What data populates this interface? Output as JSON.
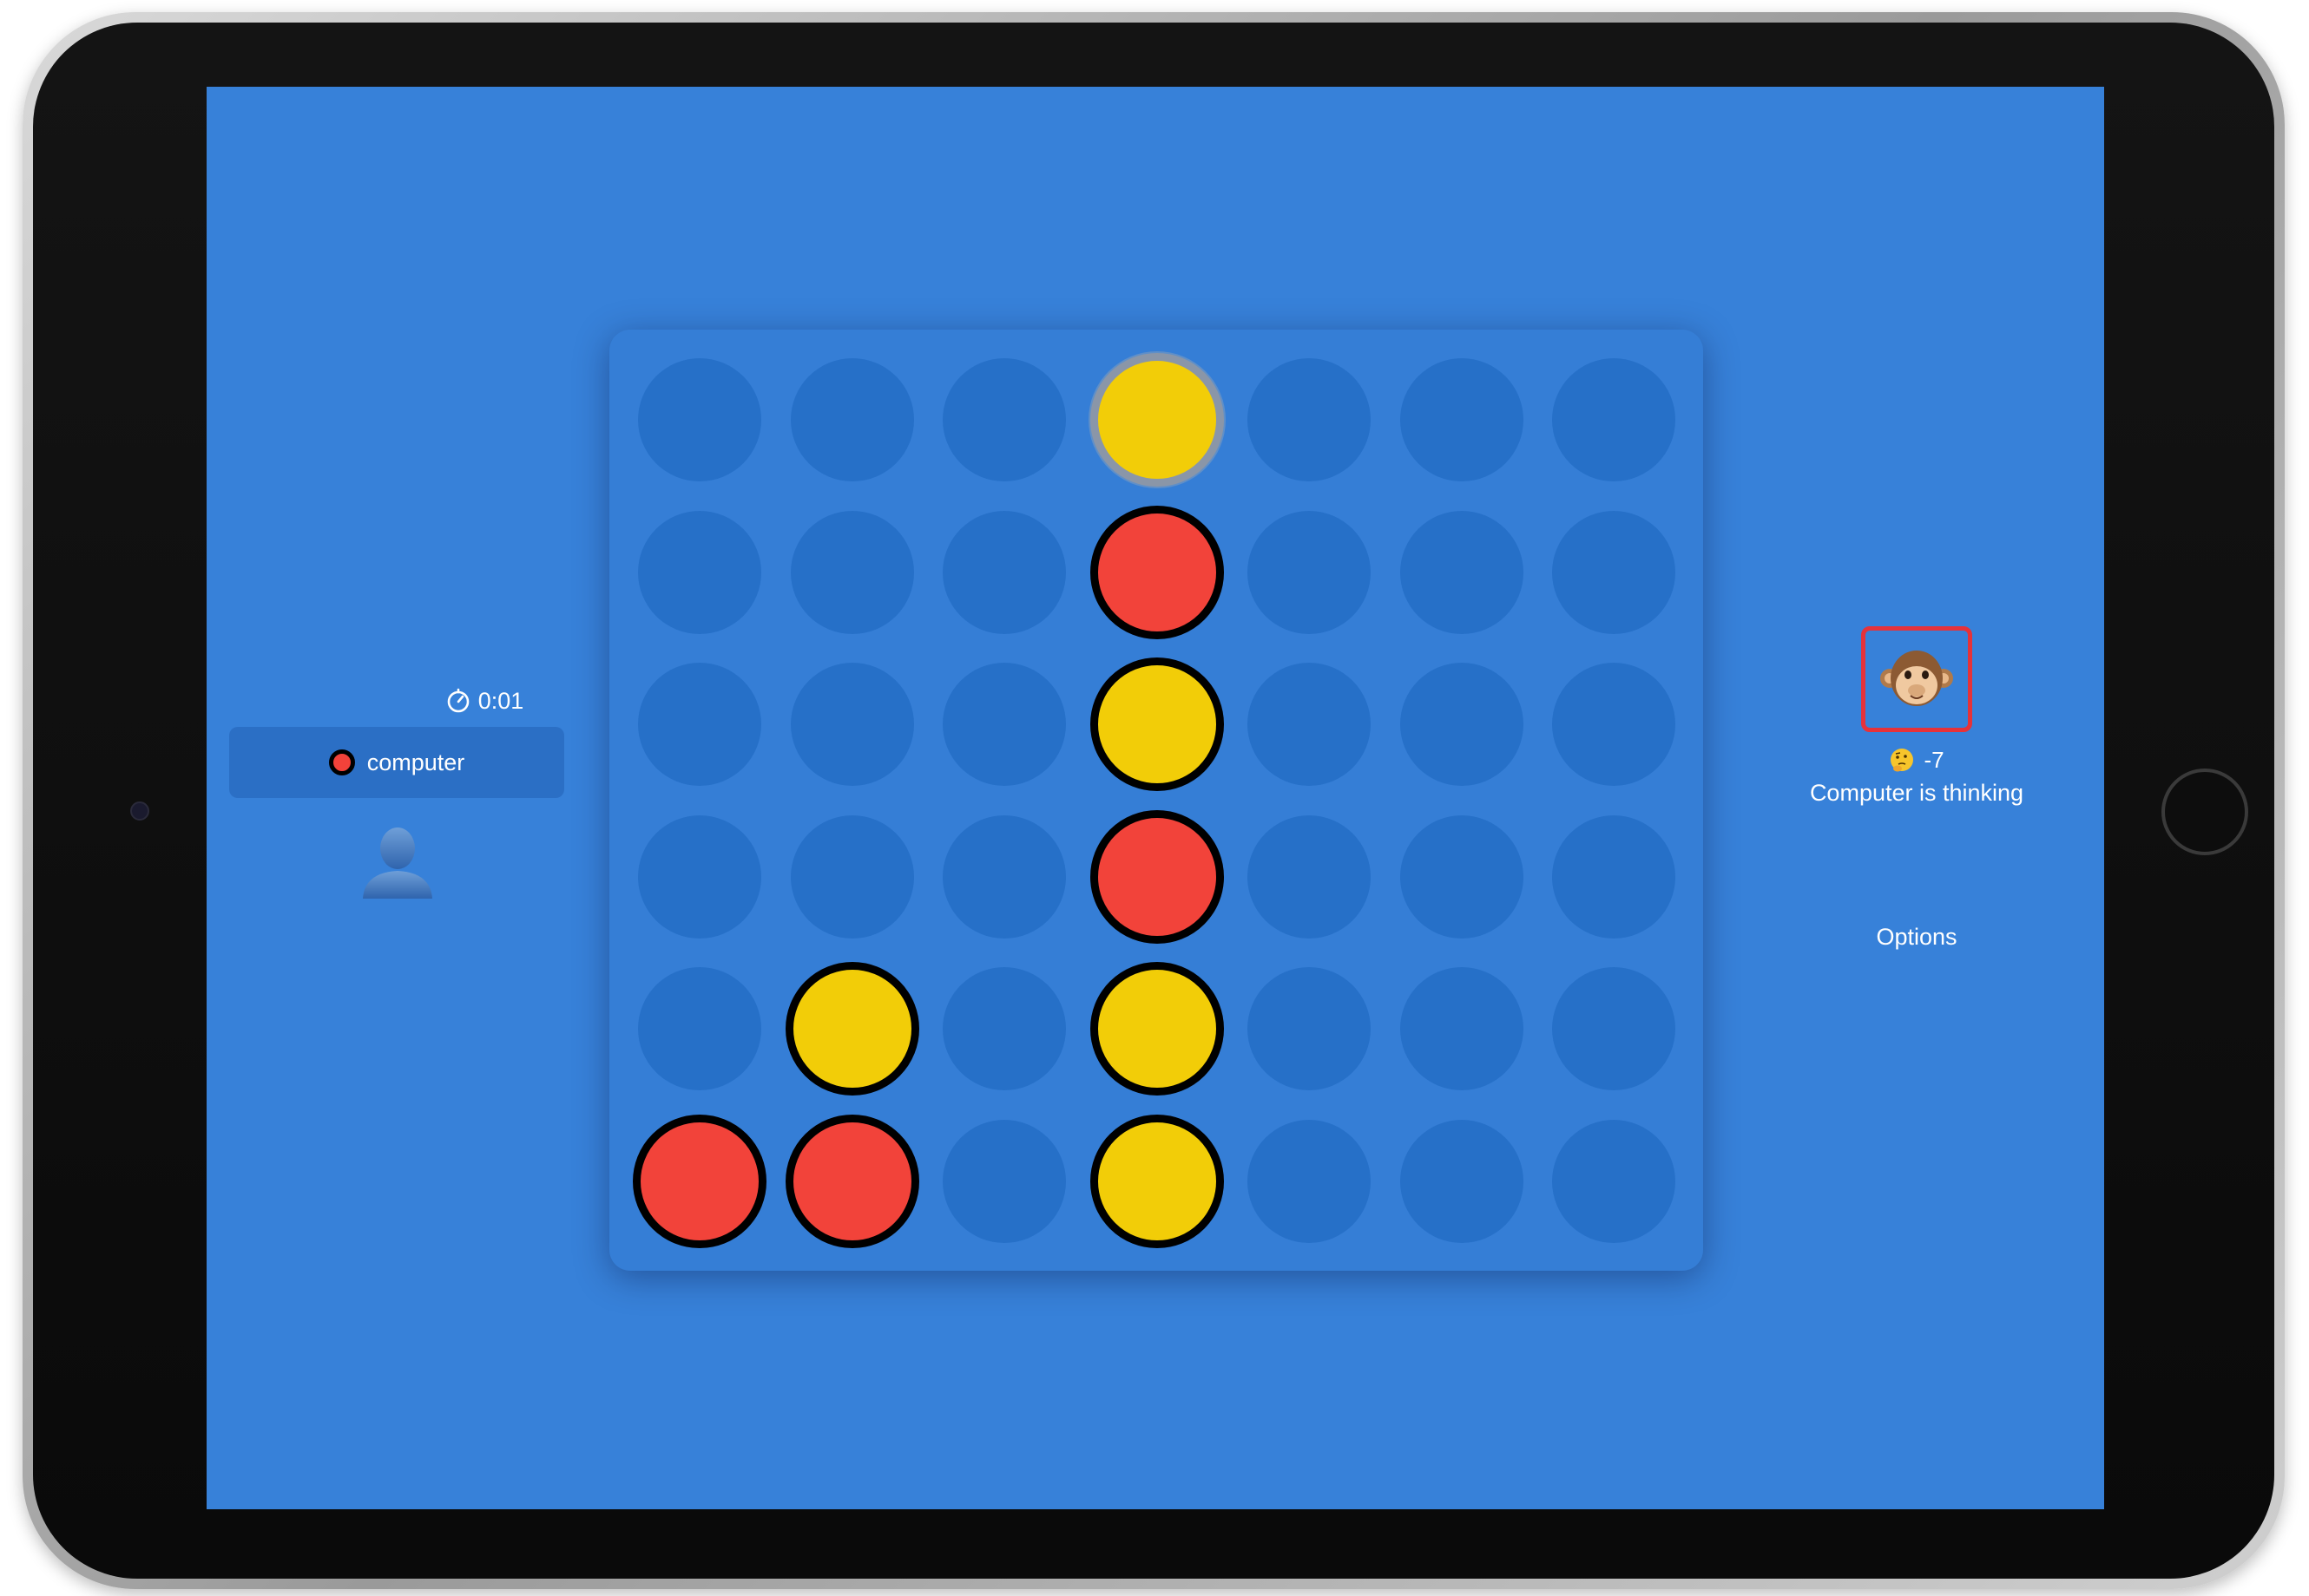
{
  "left_panel": {
    "timer": "0:01",
    "player_name": "computer",
    "player_disc_color": "#f2423a"
  },
  "board": {
    "columns": 7,
    "rows": 6,
    "grid": [
      [
        "empty",
        "empty",
        "empty",
        "yellow",
        "empty",
        "empty",
        "empty"
      ],
      [
        "empty",
        "empty",
        "empty",
        "red",
        "empty",
        "empty",
        "empty"
      ],
      [
        "empty",
        "empty",
        "empty",
        "yellow",
        "empty",
        "empty",
        "empty"
      ],
      [
        "empty",
        "empty",
        "empty",
        "red",
        "empty",
        "empty",
        "empty"
      ],
      [
        "empty",
        "yellow",
        "empty",
        "yellow",
        "empty",
        "empty",
        "empty"
      ],
      [
        "red",
        "red",
        "empty",
        "yellow",
        "empty",
        "empty",
        "empty"
      ]
    ],
    "last_move": {
      "row": 0,
      "col": 3
    },
    "colors": {
      "board": "#357ed6",
      "empty": "#2670c8",
      "red": "#f2433a",
      "yellow": "#f2cd08"
    }
  },
  "right_panel": {
    "opponent_icon": "monkey-face-icon",
    "score_icon": "thinking-face-icon",
    "score": "-7",
    "status": "Computer is thinking",
    "options_label": "Options"
  },
  "colors": {
    "background": "#3781d9",
    "highlight_border": "#e6323a"
  }
}
